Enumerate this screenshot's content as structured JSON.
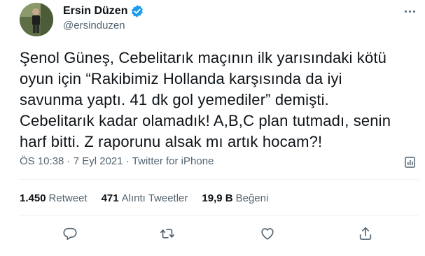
{
  "author": {
    "display_name": "Ersin Düzen",
    "handle": "@ersinduzen",
    "verified": true,
    "verified_color": "#1d9bf0"
  },
  "tweet": {
    "text": "Şenol Güneş, Cebelitarık maçının ilk yarısındaki kötü\noyun için “Rakibimiz Hollanda karşısında da iyi\nsavunma yaptı. 41 dk gol yemediler” demişti.\nCebelitarık kadar olamadık! A,B,C plan tutmadı, senin\nharf bitti. Z raporunu alsak mı artık hocam?!",
    "timestamp": "ÖS 10:38 · 7 Eyl 2021",
    "separator": " · ",
    "source": "Twitter for iPhone"
  },
  "stats": {
    "retweets": {
      "count": "1.450",
      "label": "Retweet"
    },
    "quotes": {
      "count": "471",
      "label": "Alıntı Tweetler"
    },
    "likes": {
      "count": "19,9 B",
      "label": "Beğeni"
    }
  },
  "icons": {
    "more": "more-horizontal-icon",
    "analytics": "analytics-icon",
    "reply": "reply-icon",
    "retweet": "retweet-icon",
    "like": "heart-icon",
    "share": "share-icon"
  },
  "colors": {
    "text": "#0f1419",
    "secondary": "#536471",
    "divider": "#eff3f4",
    "brand": "#1d9bf0"
  }
}
